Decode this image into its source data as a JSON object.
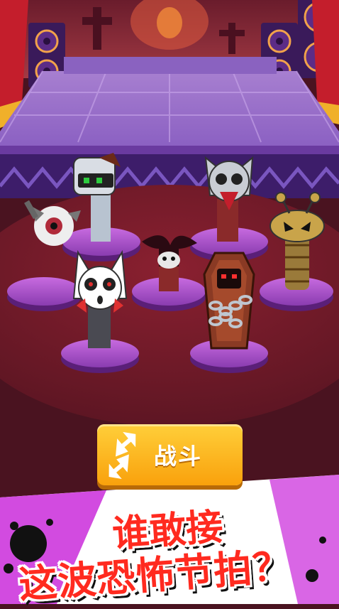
{
  "battle_button": {
    "label": "战斗"
  },
  "slogan": {
    "line1": "谁敢接",
    "line2": "这波恐怖节拍？"
  }
}
